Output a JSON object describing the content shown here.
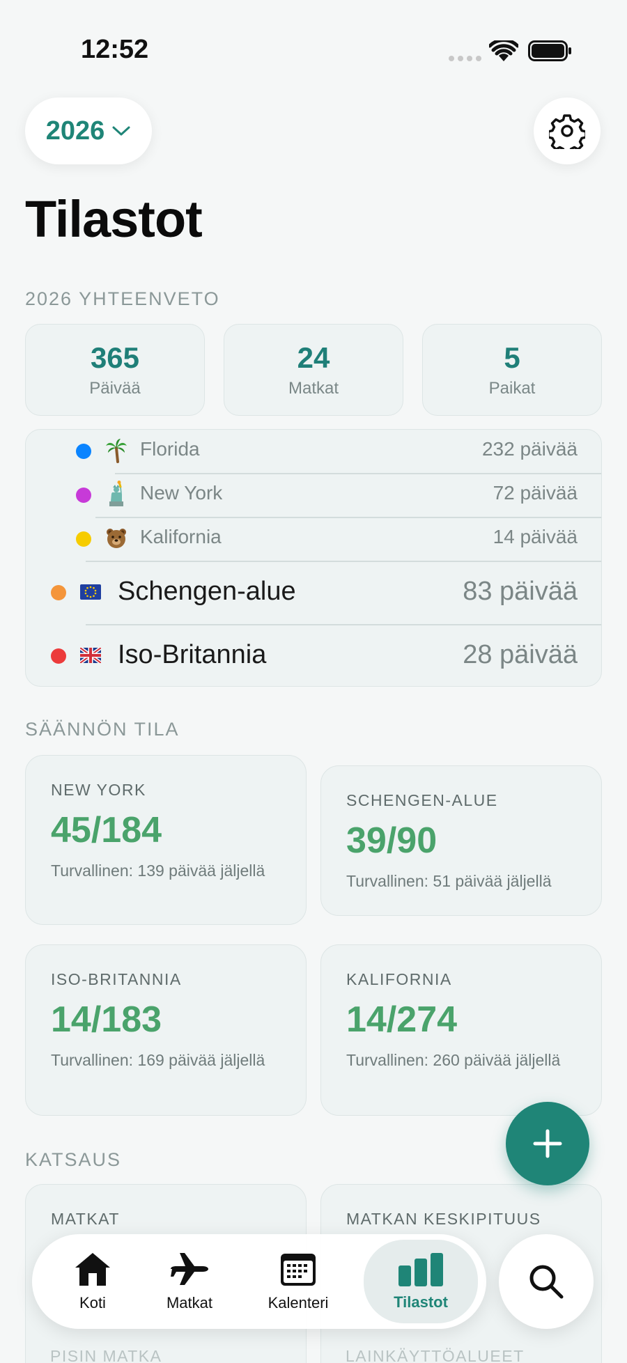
{
  "status_bar": {
    "time": "12:52"
  },
  "header": {
    "year": "2026",
    "title": "Tilastot"
  },
  "summary": {
    "section_label": "2026 YHTEENVETO",
    "cards": [
      {
        "value": "365",
        "label": "Päivää"
      },
      {
        "value": "24",
        "label": "Matkat"
      },
      {
        "value": "5",
        "label": "Paikat"
      }
    ]
  },
  "regions": {
    "sub": [
      {
        "name": "Florida",
        "days": "232 päivää",
        "dot_color": "#0a84ff",
        "icon": "palm-tree-icon"
      },
      {
        "name": "New York",
        "days": "72 päivää",
        "dot_color": "#c73ad8",
        "icon": "statue-of-liberty-icon"
      },
      {
        "name": "Kalifornia",
        "days": "14 päivää",
        "dot_color": "#f6cc00",
        "icon": "bear-icon"
      }
    ],
    "main": [
      {
        "name": "Schengen-alue",
        "days": "83 päivää",
        "dot_color": "#f4953a",
        "icon": "eu-flag-icon"
      },
      {
        "name": "Iso-Britannia",
        "days": "28 päivää",
        "dot_color": "#ec3b3b",
        "icon": "uk-flag-icon"
      }
    ]
  },
  "rules": {
    "section_label": "SÄÄNNÖN TILA",
    "cards": [
      {
        "label": "NEW YORK",
        "value": "45/184",
        "sub": "Turvallinen: 139 päivää jäljellä"
      },
      {
        "label": "SCHENGEN-ALUE",
        "value": "39/90",
        "sub": "Turvallinen: 51 päivää jäljellä"
      },
      {
        "label": "ISO-BRITANNIA",
        "value": "14/183",
        "sub": "Turvallinen: 169 päivää jäljellä"
      },
      {
        "label": "KALIFORNIA",
        "value": "14/274",
        "sub": "Turvallinen: 260 päivää jäljellä"
      }
    ]
  },
  "overview": {
    "section_label": "KATSAUS",
    "cards": [
      {
        "label": "MATKAT"
      },
      {
        "label": "MATKAN KESKIPITUUS"
      }
    ],
    "lower_labels": [
      "PISIN MATKA",
      "LAINKÄYTTÖALUEET"
    ]
  },
  "tabs": [
    {
      "label": "Koti",
      "icon": "home-icon"
    },
    {
      "label": "Matkat",
      "icon": "airplane-icon"
    },
    {
      "label": "Kalenteri",
      "icon": "calendar-icon"
    },
    {
      "label": "Tilastot",
      "icon": "bar-chart-icon"
    }
  ],
  "colors": {
    "accent": "#1f8577",
    "safe_green": "#4aa36b"
  }
}
